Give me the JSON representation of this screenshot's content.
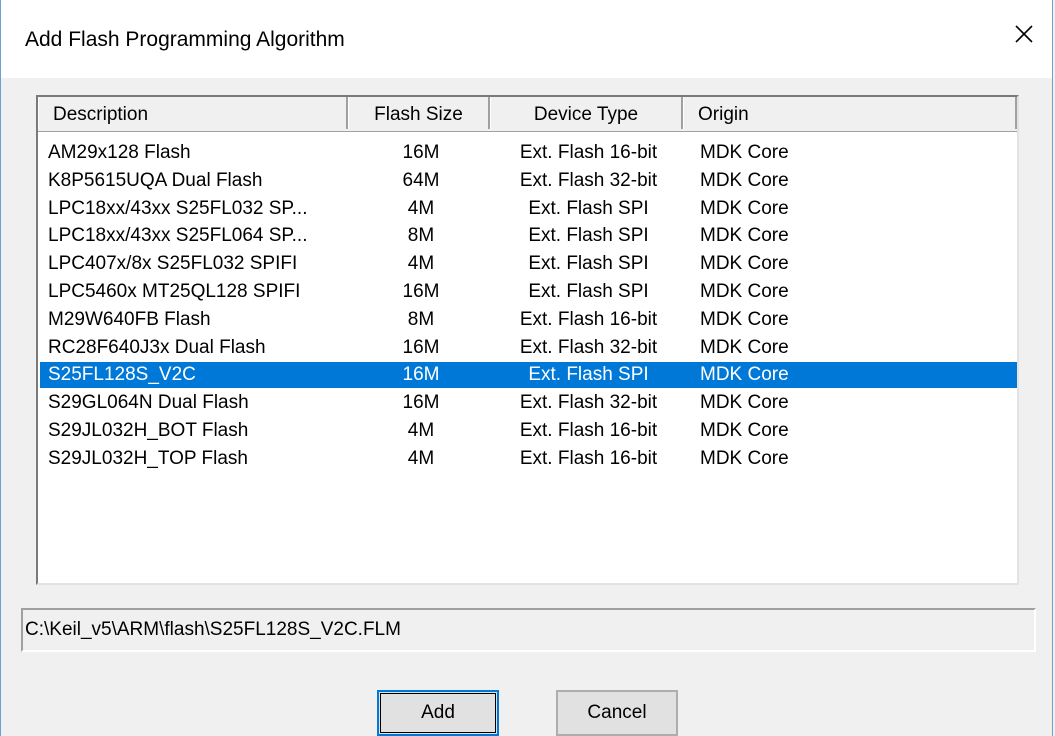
{
  "window": {
    "title": "Add Flash Programming Algorithm"
  },
  "list": {
    "columns": [
      "Description",
      "Flash Size",
      "Device Type",
      "Origin"
    ],
    "rows": [
      {
        "description": "AM29x128 Flash",
        "size": "16M",
        "type": "Ext. Flash 16-bit",
        "origin": "MDK Core"
      },
      {
        "description": "K8P5615UQA Dual Flash",
        "size": "64M",
        "type": "Ext. Flash 32-bit",
        "origin": "MDK Core"
      },
      {
        "description": "LPC18xx/43xx S25FL032 SP...",
        "size": "4M",
        "type": "Ext. Flash SPI",
        "origin": "MDK Core"
      },
      {
        "description": "LPC18xx/43xx S25FL064 SP...",
        "size": "8M",
        "type": "Ext. Flash SPI",
        "origin": "MDK Core"
      },
      {
        "description": "LPC407x/8x S25FL032 SPIFI",
        "size": "4M",
        "type": "Ext. Flash SPI",
        "origin": "MDK Core"
      },
      {
        "description": "LPC5460x MT25QL128 SPIFI",
        "size": "16M",
        "type": "Ext. Flash SPI",
        "origin": "MDK Core"
      },
      {
        "description": "M29W640FB Flash",
        "size": "8M",
        "type": "Ext. Flash 16-bit",
        "origin": "MDK Core"
      },
      {
        "description": "RC28F640J3x Dual Flash",
        "size": "16M",
        "type": "Ext. Flash 32-bit",
        "origin": "MDK Core"
      },
      {
        "description": "S25FL128S_V2C",
        "size": "16M",
        "type": "Ext. Flash SPI",
        "origin": "MDK Core"
      },
      {
        "description": "S29GL064N Dual Flash",
        "size": "16M",
        "type": "Ext. Flash 32-bit",
        "origin": "MDK Core"
      },
      {
        "description": "S29JL032H_BOT Flash",
        "size": "4M",
        "type": "Ext. Flash 16-bit",
        "origin": "MDK Core"
      },
      {
        "description": "S29JL032H_TOP Flash",
        "size": "4M",
        "type": "Ext. Flash 16-bit",
        "origin": "MDK Core"
      }
    ],
    "selected_index": 8
  },
  "path": {
    "value": "C:\\Keil_v5\\ARM\\flash\\S25FL128S_V2C.FLM"
  },
  "buttons": {
    "add_label": "Add",
    "cancel_label": "Cancel"
  },
  "colors": {
    "selection": "#0078d7",
    "accent_border": "#6f9fd8"
  },
  "icons": {
    "close": "close-icon"
  }
}
